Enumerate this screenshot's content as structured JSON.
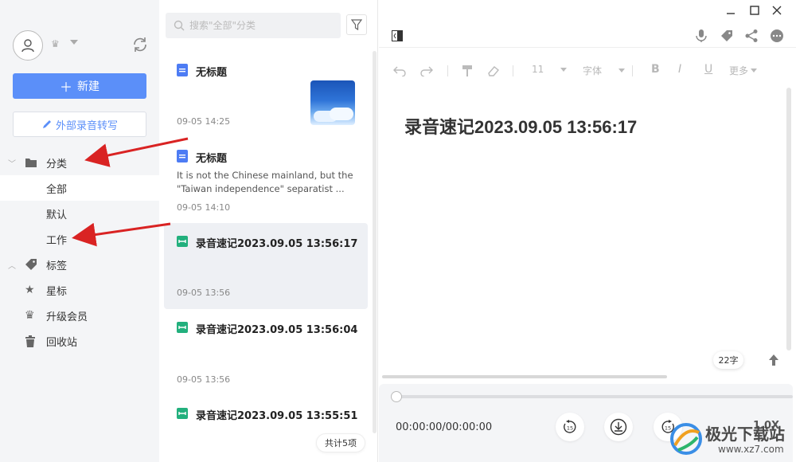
{
  "sidebar": {
    "new_label": "新建",
    "ext_label": "外部录音转写",
    "category_label": "分类",
    "categories": [
      "全部",
      "默认",
      "工作"
    ],
    "tags_label": "标签",
    "star_label": "星标",
    "upgrade_label": "升级会员",
    "trash_label": "回收站"
  },
  "notelist": {
    "search_placeholder": "搜索\"全部\"分类",
    "notes": [
      {
        "title": "无标题",
        "date": "09-05 14:25",
        "snippet": ""
      },
      {
        "title": "无标题",
        "date": "09-05 14:10",
        "snippet": "It is not the Chinese mainland, but the \"Taiwan independence\" separatist ..."
      },
      {
        "title": "录音速记2023.09.05 13:56:17",
        "date": "09-05 13:56",
        "snippet": ""
      },
      {
        "title": "录音速记2023.09.05 13:56:04",
        "date": "09-05 13:56",
        "snippet": ""
      },
      {
        "title": "录音速记2023.09.05 13:55:51",
        "date": "",
        "snippet": ""
      }
    ],
    "count_label": "共计5项"
  },
  "editor": {
    "format": {
      "font_size": "11",
      "font_family": "字体",
      "more": "更多"
    },
    "doc_title": "录音速记2023.09.05 13:56:17",
    "word_count": "22字",
    "player": {
      "time": "00:00:00/00:00:00",
      "progress": 0,
      "speed": "1.0X",
      "rewind_label": "15",
      "forward_label": "15"
    }
  },
  "watermark": {
    "name": "极光下载站",
    "url": "www.xz7.com"
  },
  "colors": {
    "accent": "#5b8ff9",
    "arrow": "#d92323",
    "note_icon_blue": "#4d7cf4",
    "note_icon_green": "#22b07d"
  }
}
